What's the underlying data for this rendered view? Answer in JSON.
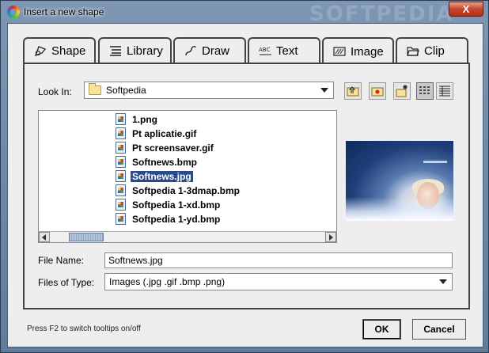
{
  "window": {
    "title": "Insert a new shape",
    "watermark": "SOFTPEDIA",
    "close_label": "X"
  },
  "tabs": [
    {
      "label": "Shape",
      "icon": "shape-icon"
    },
    {
      "label": "Library",
      "icon": "list-icon"
    },
    {
      "label": "Draw",
      "icon": "pen-icon"
    },
    {
      "label": "Text",
      "icon": "abc-icon"
    },
    {
      "label": "Image",
      "icon": "image-icon",
      "active": true
    },
    {
      "label": "Clip",
      "icon": "folder-open-icon"
    }
  ],
  "look_in": {
    "label": "Look In:",
    "value": "Softpedia"
  },
  "toolbar": [
    "up-folder-icon",
    "home-folder-icon",
    "new-folder-icon",
    "list-view-icon",
    "details-view-icon"
  ],
  "files": [
    {
      "name": "1.png"
    },
    {
      "name": "Pt aplicatie.gif"
    },
    {
      "name": "Pt screensaver.gif"
    },
    {
      "name": "Softnews.bmp"
    },
    {
      "name": "Softnews.jpg",
      "selected": true
    },
    {
      "name": "Softpedia 1-3dmap.bmp"
    },
    {
      "name": "Softpedia 1-xd.bmp"
    },
    {
      "name": "Softpedia 1-yd.bmp"
    }
  ],
  "file_name": {
    "label": "File Name:",
    "value": "Softnews.jpg"
  },
  "file_type": {
    "label": "Files of Type:",
    "value": "Images (.jpg .gif .bmp .png)"
  },
  "hint": "Press F2 to switch tooltips on/off",
  "buttons": {
    "ok": "OK",
    "cancel": "Cancel"
  }
}
